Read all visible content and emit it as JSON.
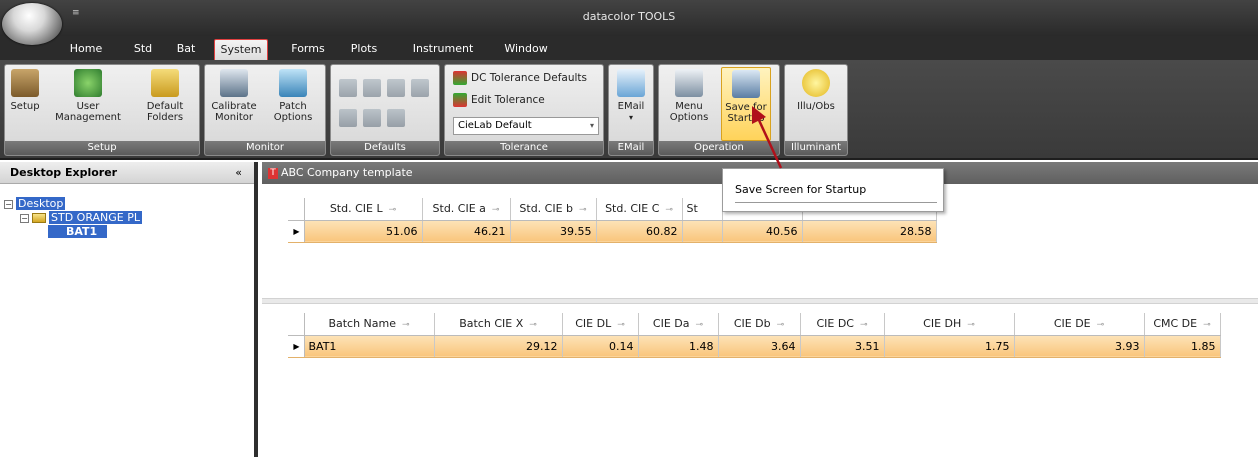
{
  "window": {
    "title": "datacolor TOOLS",
    "qat_glyph": "≡"
  },
  "tabs": [
    "Home",
    "Std",
    "Bat",
    "System",
    "Forms",
    "Plots",
    "Instrument",
    "Window"
  ],
  "active_tab": "System",
  "ribbon": {
    "setup": {
      "label": "Setup",
      "buttons": [
        "Setup",
        "User\nManagement",
        "Default\nFolders"
      ]
    },
    "monitor": {
      "label": "Monitor",
      "buttons": [
        "Calibrate\nMonitor",
        "Patch\nOptions"
      ]
    },
    "defaults": {
      "label": "Defaults"
    },
    "tolerance": {
      "label": "Tolerance",
      "dc_defaults": "DC Tolerance Defaults",
      "edit": "Edit Tolerance",
      "dropdown": "CieLab Default"
    },
    "email": {
      "label": "EMail",
      "button": "EMail"
    },
    "operation": {
      "label": "Operation",
      "buttons": [
        "Menu\nOptions",
        "Save for\nStartup"
      ]
    },
    "illuminant": {
      "label": "Illuminant",
      "button": "Illu/Obs"
    }
  },
  "sidebar": {
    "title": "Desktop Explorer",
    "collapse": "«",
    "tree": {
      "root": "Desktop",
      "std": "STD ORANGE PL",
      "batch": "BAT1"
    }
  },
  "document": {
    "title": "ABC Company template",
    "badge": "T"
  },
  "std_table": {
    "headers": [
      "Std. CIE L",
      "Std. CIE a",
      "Std. CIE b",
      "Std. CIE C",
      "St",
      "",
      ""
    ],
    "row": [
      "51.06",
      "46.21",
      "39.55",
      "60.82",
      "",
      "40.56",
      "28.58"
    ]
  },
  "batch_table": {
    "headers": [
      "Batch Name",
      "Batch CIE X",
      "CIE DL",
      "CIE Da",
      "CIE Db",
      "CIE DC",
      "CIE DH",
      "CIE DE",
      "CMC DE"
    ],
    "row": [
      "BAT1",
      "29.12",
      "0.14",
      "1.48",
      "3.64",
      "3.51",
      "1.75",
      "3.93",
      "1.85"
    ]
  },
  "tooltip": {
    "text": "Save Screen for Startup"
  },
  "colors": {
    "highlight_row": "#f9c57c",
    "selection": "#3468c8",
    "annotation_arrow": "#b0101a"
  }
}
